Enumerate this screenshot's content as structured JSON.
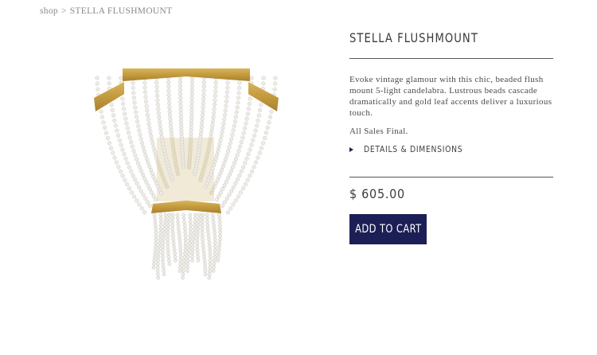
{
  "breadcrumb": {
    "shop": "shop",
    "separator": ">",
    "current": "STELLA FLUSHMOUNT"
  },
  "product": {
    "title": "STELLA FLUSHMOUNT",
    "description": "Evoke vintage glamour with this chic, beaded flush mount 5-light candelabra. Lustrous beads cascade dramatically and gold leaf accents deliver a luxurious touch.",
    "sales_note": "All Sales Final.",
    "details_label": "DETAILS & DIMENSIONS",
    "price": "$ 605.00",
    "add_to_cart_label": "ADD TO CART",
    "image_icon": "beaded-chandelier-image"
  },
  "colors": {
    "accent": "#1c1f56",
    "gold": "#c9a24a",
    "bead": "#e9e8e3",
    "text": "#444444"
  }
}
